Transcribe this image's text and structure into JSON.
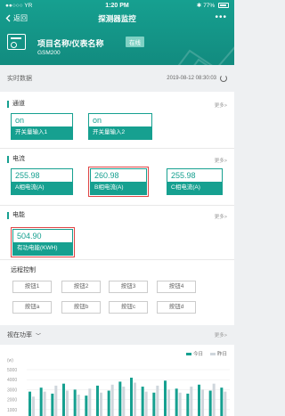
{
  "statusbar": {
    "carrier": "●●○○○ YR",
    "time": "1:20 PM",
    "battery": "77%"
  },
  "nav": {
    "back_label": "返回",
    "title": "探测器监控",
    "more": "•••"
  },
  "device": {
    "name": "项目名称/仪表名称",
    "status": "在线",
    "model": "GSM200"
  },
  "realtime": {
    "label": "实时数据",
    "timestamp": "2019-08-12 08:30:03"
  },
  "channel": {
    "title": "通道",
    "more": "更多>",
    "items": [
      {
        "value": "on",
        "label": "开关量输入1"
      },
      {
        "value": "on",
        "label": "开关量输入2"
      }
    ]
  },
  "current": {
    "title": "电流",
    "more": "更多>",
    "items": [
      {
        "value": "255.98",
        "label": "A相电流(A)"
      },
      {
        "value": "260.98",
        "label": "B相电流(A)"
      },
      {
        "value": "255.98",
        "label": "C相电流(A)"
      }
    ]
  },
  "energy": {
    "title": "电能",
    "more": "更多>",
    "items": [
      {
        "value": "504.90",
        "label": "有功电能(KWH)"
      }
    ]
  },
  "remote": {
    "title": "远程控制",
    "buttons": [
      "按钮1",
      "按钮2",
      "按钮3",
      "按钮4",
      "按钮a",
      "按钮b",
      "按钮c",
      "按钮d"
    ]
  },
  "power": {
    "title": "视在功率",
    "more": "更多>"
  },
  "colors": {
    "accent": "#16a090",
    "highlight": "#e04545",
    "yesterday": "#cfd6dc"
  },
  "chart_data": {
    "type": "bar",
    "ylabel": "(w)",
    "yticks": [
      "5000",
      "4000",
      "3000",
      "2000",
      "1000"
    ],
    "ylim": [
      0,
      5000
    ],
    "series": [
      {
        "name": "今日",
        "values": [
          2800,
          3200,
          2600,
          3600,
          3000,
          2400,
          3400,
          2900,
          3800,
          4200,
          3300,
          2700,
          3900,
          3100,
          2600,
          3500,
          2900,
          3200
        ]
      },
      {
        "name": "昨日",
        "values": [
          2300,
          2800,
          3400,
          2900,
          2500,
          3100,
          2700,
          3500,
          3300,
          3700,
          2800,
          3400,
          3000,
          2700,
          3300,
          3000,
          3600,
          2800
        ]
      }
    ]
  }
}
